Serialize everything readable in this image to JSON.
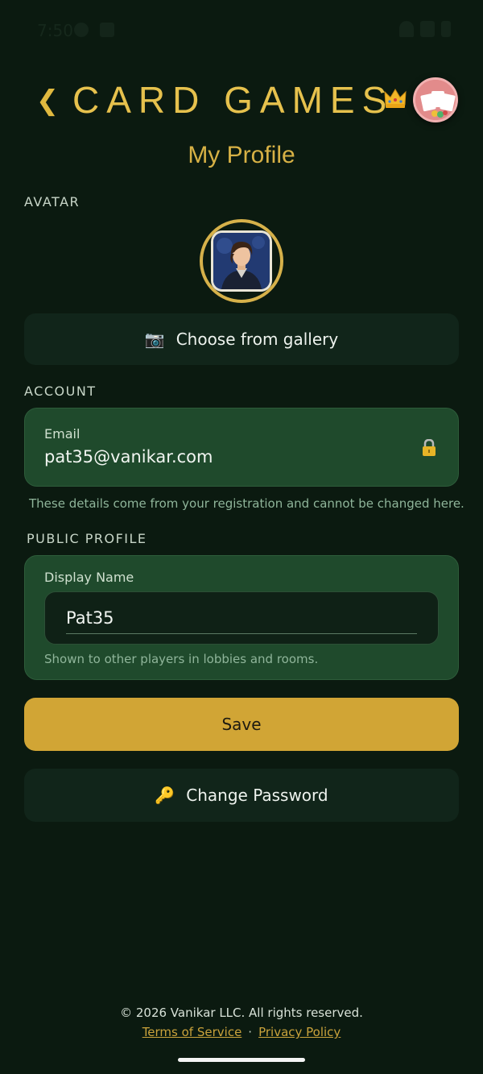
{
  "status_bar": {
    "time": "7:50"
  },
  "header": {
    "back_glyph": "❮",
    "app_title": "CARD GAMES",
    "crown_icon": "crown-icon"
  },
  "page_title": "My Profile",
  "avatar_section": {
    "label": "AVATAR",
    "choose_gallery_icon": "📷",
    "choose_gallery_label": "Choose from gallery"
  },
  "account": {
    "label": "ACCOUNT",
    "email_label": "Email",
    "email_value": "pat35@vanikar.com",
    "hint": "These details come from your registration and cannot be changed here."
  },
  "public_profile": {
    "label": "PUBLIC PROFILE",
    "display_name_label": "Display Name",
    "display_name_value": "Pat35",
    "hint": "Shown to other players in lobbies and rooms."
  },
  "actions": {
    "save_label": "Save",
    "change_password_icon": "🔑",
    "change_password_label": "Change Password"
  },
  "footer": {
    "copyright": "© 2026 Vanikar LLC. All rights reserved.",
    "terms_label": "Terms of Service",
    "separator": "·",
    "privacy_label": "Privacy Policy"
  },
  "colors": {
    "background": "#0b1a10",
    "accent_gold": "#d1a535",
    "card_green": "#1f4a2c"
  }
}
